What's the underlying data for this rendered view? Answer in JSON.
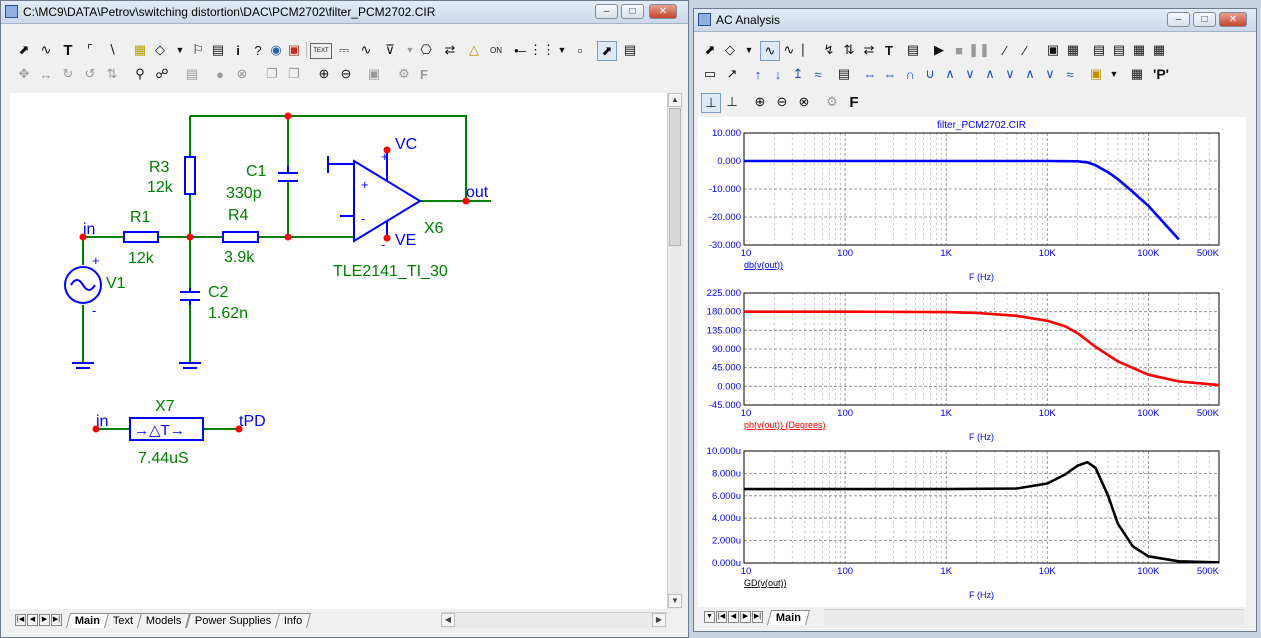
{
  "schematic_window": {
    "title": "C:\\MC9\\DATA\\Petrov\\switching distortion\\DAC\\PCM2702\\filter_PCM2702.CIR",
    "tabs": [
      "Main",
      "Text",
      "Models",
      "Power Supplies",
      "Info"
    ],
    "active_tab": "Main",
    "toolbar_text_button": "TEXT",
    "components": {
      "r1": {
        "name": "R1",
        "value": "12k"
      },
      "r3": {
        "name": "R3",
        "value": "12k"
      },
      "r4": {
        "name": "R4",
        "value": "3.9k"
      },
      "c1": {
        "name": "C1",
        "value": "330p"
      },
      "c2": {
        "name": "C2",
        "value": "1.62n"
      },
      "v1": {
        "name": "V1"
      },
      "x6": {
        "name": "X6",
        "model": "TLE2141_TI_30"
      },
      "x7": {
        "name": "X7",
        "value": "7.44uS"
      }
    },
    "nodes": {
      "in": "in",
      "out": "out",
      "vc": "VC",
      "ve": "VE",
      "tpd": "tPD",
      "in2": "in"
    },
    "colors": {
      "wire": "#008000",
      "component": "#0000ff",
      "node": "#ff0000"
    }
  },
  "analysis_window": {
    "title": "AC Analysis",
    "tabs": [
      "Main"
    ],
    "active_tab": "Main",
    "plot_title": "filter_PCM2702.CIR",
    "x_tick_labels": [
      "10",
      "100",
      "1K",
      "10K",
      "100K",
      "500K"
    ],
    "x_axis_label": "F (Hz)"
  },
  "chart_data": [
    {
      "type": "line",
      "title": "filter_PCM2702.CIR",
      "xlabel": "F (Hz)",
      "ylabel": "db(v(out))",
      "x_scale": "log",
      "xlim": [
        10,
        500000
      ],
      "ylim": [
        -30,
        10
      ],
      "y_tick_labels": [
        "10.000",
        "0.000",
        "-10.000",
        "-20.000",
        "-30.000"
      ],
      "grid": true,
      "color": "#0000ff",
      "series": [
        {
          "name": "db(v(out))",
          "x": [
            10,
            100,
            1000,
            10000,
            20000,
            25000,
            30000,
            40000,
            50000,
            70000,
            100000,
            150000,
            200000
          ],
          "y": [
            0,
            0,
            0,
            0,
            -0.1,
            -0.5,
            -1.5,
            -4,
            -6.5,
            -11,
            -16,
            -23,
            -28
          ]
        }
      ]
    },
    {
      "type": "line",
      "xlabel": "F (Hz)",
      "ylabel": "ph(v(out)) (Degrees)",
      "x_scale": "log",
      "xlim": [
        10,
        500000
      ],
      "ylim": [
        -45,
        225
      ],
      "y_tick_labels": [
        "225.000",
        "180.000",
        "135.000",
        "90.000",
        "45.000",
        "0.000",
        "-45.000"
      ],
      "grid": true,
      "color": "#ff0000",
      "series": [
        {
          "name": "ph(v(out)) (Degrees)",
          "x": [
            10,
            100,
            1000,
            2000,
            5000,
            10000,
            15000,
            20000,
            30000,
            50000,
            100000,
            200000,
            500000
          ],
          "y": [
            180,
            180,
            179,
            177,
            170,
            158,
            145,
            128,
            95,
            60,
            28,
            12,
            3
          ]
        }
      ]
    },
    {
      "type": "line",
      "xlabel": "F (Hz)",
      "ylabel": "GD(v(out))",
      "x_scale": "log",
      "xlim": [
        10,
        500000
      ],
      "ylim": [
        0,
        10
      ],
      "y_unit": "u",
      "y_tick_labels": [
        "10.000u",
        "8.000u",
        "6.000u",
        "4.000u",
        "2.000u",
        "0.000u"
      ],
      "grid": true,
      "color": "#000000",
      "series": [
        {
          "name": "GD(v(out))",
          "x": [
            10,
            100,
            1000,
            5000,
            10000,
            15000,
            20000,
            25000,
            30000,
            40000,
            50000,
            70000,
            100000,
            200000,
            500000
          ],
          "y": [
            6.6,
            6.6,
            6.6,
            6.65,
            7.1,
            7.9,
            8.7,
            9.0,
            8.5,
            6.0,
            3.5,
            1.5,
            0.6,
            0.15,
            0.05
          ]
        }
      ]
    }
  ]
}
